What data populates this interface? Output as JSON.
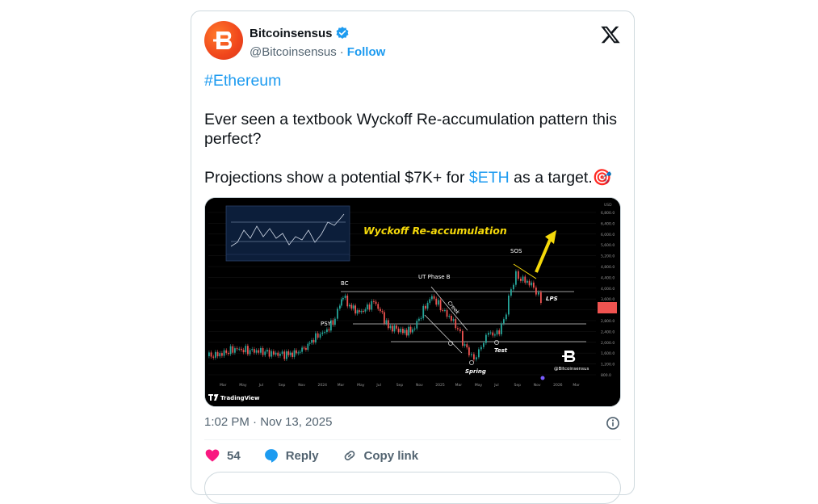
{
  "author": {
    "display_name": "Bitcoinsensus",
    "handle": "@Bitcoinsensus",
    "separator": "·",
    "follow_label": "Follow",
    "avatar_letter": "B",
    "avatar_color": "#f0461c",
    "verified_color": "#1d9bf0"
  },
  "tweet": {
    "hashtag": "#Ethereum",
    "line2": "Ever seen a textbook Wyckoff Re-accumulation pattern this perfect?",
    "line3_before": "Projections show a potential $7K+ for ",
    "cashtag": "$ETH",
    "line3_after": " as a target.",
    "emoji": "🎯"
  },
  "media": {
    "chart_title": "Wyckoff Re-accumulation",
    "labels": {
      "psy": "PSY",
      "bc": "BC",
      "ut": "UT Phase B",
      "creek": "Creek",
      "spring": "Spring",
      "test": "Test",
      "sos": "SOS",
      "lps": "LPS"
    },
    "watermark_handle": "@Bitcoinsensus",
    "tradingview_label": "TradingView",
    "price_ticks": [
      "6,800.0",
      "6,400.0",
      "6,000.0",
      "5,600.0",
      "5,200.0",
      "4,800.0",
      "4,400.0",
      "4,000.0",
      "3,600.0",
      "3,200.0",
      "2,800.0",
      "2,400.0",
      "2,000.0",
      "1,600.0",
      "1,200.0",
      "800.0"
    ],
    "time_ticks": [
      "Mar",
      "May",
      "Jul",
      "Sep",
      "Nov",
      "2024",
      "Mar",
      "May",
      "Jul",
      "Sep",
      "Nov",
      "2025",
      "Mar",
      "May",
      "Jul",
      "Sep",
      "Nov",
      "2026",
      "Mar"
    ],
    "usd_label": "USD",
    "accent_yellow": "#f5d90a",
    "up_color": "#26a69a",
    "down_color": "#ef5350"
  },
  "footer": {
    "timestamp": "1:02 PM · Nov 13, 2025",
    "like_count": "54",
    "reply_label": "Reply",
    "copy_label": "Copy link"
  }
}
